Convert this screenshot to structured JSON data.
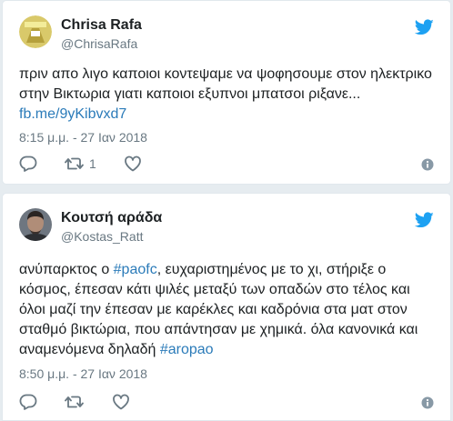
{
  "tweets": [
    {
      "author_name": "Chrisa Rafa",
      "handle": "@ChrisaRafa",
      "text_line1": "πριν απο λιγο καποιοι κοντεψαμε να ψοφησουμε στον ηλεκτρικο",
      "text_line2": "στην Βικτωρια γιατι καποιοι εξυπνοι μπατσοι ριξανε...",
      "link": "fb.me/9yKibvxd7",
      "timestamp": "8:15 μ.μ. - 27 Ιαν 2018",
      "retweet_count": "1",
      "icons": [
        "reply-icon",
        "retweet-icon",
        "like-icon",
        "info-icon",
        "twitter-bird-icon"
      ]
    },
    {
      "author_name": "Κουτσή αράδα",
      "handle": "@Kostas_Ratt",
      "text_p1": "ανύπαρκτος ο ",
      "hashtag1": "#paofc",
      "text_p2": ", ευχαριστημένος με το χι, στήριξε ο κόσμος, έπεσαν κάτι ψιλές μεταξύ των οπαδών στο τέλος και όλοι μαζί την έπεσαν με καρέκλες και καδρόνια στα ματ στον σταθμό βικτώρια, που απάντησαν με χημικά. όλα κανονικά και αναμενόμενα δηλαδή ",
      "hashtag2": "#aropao",
      "timestamp": "8:50 μ.μ. - 27 Ιαν 2018",
      "icons": [
        "reply-icon",
        "retweet-icon",
        "like-icon",
        "info-icon",
        "twitter-bird-icon"
      ]
    }
  ],
  "colors": {
    "link": "#2b7bb9",
    "twitter_blue": "#1da1f2",
    "meta_gray": "#697882",
    "background": "#e6ecf0"
  }
}
